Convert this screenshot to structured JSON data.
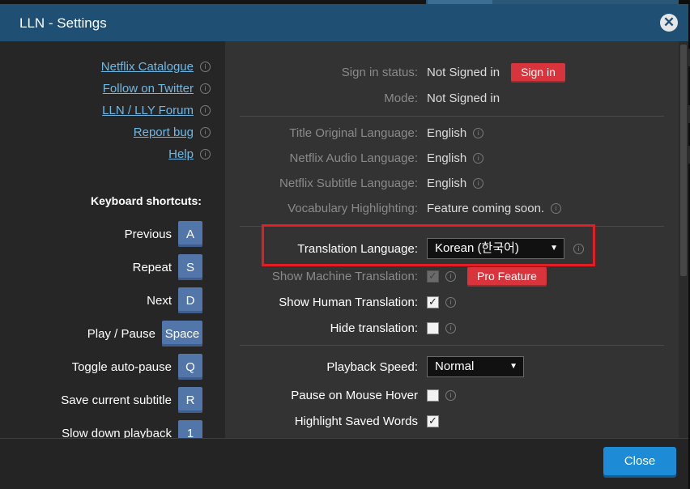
{
  "window": {
    "title": "LLN - Settings",
    "close_icon": "close-icon"
  },
  "sidebar": {
    "links": [
      {
        "label": "Netflix Catalogue",
        "icon": "info-icon"
      },
      {
        "label": "Follow on Twitter",
        "icon": "info-icon"
      },
      {
        "label": "LLN / LLY Forum",
        "icon": "info-icon"
      },
      {
        "label": "Report bug",
        "icon": "info-icon"
      },
      {
        "label": "Help",
        "icon": "info-icon"
      }
    ],
    "keyboard_title": "Keyboard shortcuts:",
    "shortcuts": [
      {
        "label": "Previous",
        "key": "A"
      },
      {
        "label": "Repeat",
        "key": "S"
      },
      {
        "label": "Next",
        "key": "D"
      },
      {
        "label": "Play / Pause",
        "key": "Space"
      },
      {
        "label": "Toggle auto-pause",
        "key": "Q"
      },
      {
        "label": "Save current subtitle",
        "key": "R"
      },
      {
        "label": "Slow down playback",
        "key": "1"
      }
    ]
  },
  "main": {
    "sign_in_status_label": "Sign in status:",
    "sign_in_status_value": "Not Signed in",
    "sign_in_button": "Sign in",
    "mode_label": "Mode:",
    "mode_value": "Not Signed in",
    "title_original_language_label": "Title Original Language:",
    "title_original_language_value": "English",
    "audio_language_label": "Netflix Audio Language:",
    "audio_language_value": "English",
    "subtitle_language_label": "Netflix Subtitle Language:",
    "subtitle_language_value": "English",
    "vocab_label": "Vocabulary Highlighting:",
    "vocab_value": "Feature coming soon.",
    "translation_language_label": "Translation Language:",
    "translation_language_value": "Korean (한국어)",
    "machine_translation_label": "Show Machine Translation:",
    "machine_translation_checked": true,
    "pro_feature_label": "Pro Feature",
    "human_translation_label": "Show Human Translation:",
    "human_translation_checked": true,
    "hide_translation_label": "Hide translation:",
    "hide_translation_checked": false,
    "playback_speed_label": "Playback Speed:",
    "playback_speed_value": "Normal",
    "pause_hover_label": "Pause on Mouse Hover",
    "pause_hover_checked": false,
    "highlight_saved_label": "Highlight Saved Words",
    "highlight_saved_checked": true
  },
  "footer": {
    "close_label": "Close"
  },
  "colors": {
    "titlebar": "#1f4f73",
    "link": "#6fb8e6",
    "key": "#5276aa",
    "red_button": "#d9343b",
    "close_button": "#1d8bd6",
    "highlight_box": "#e21d24"
  }
}
